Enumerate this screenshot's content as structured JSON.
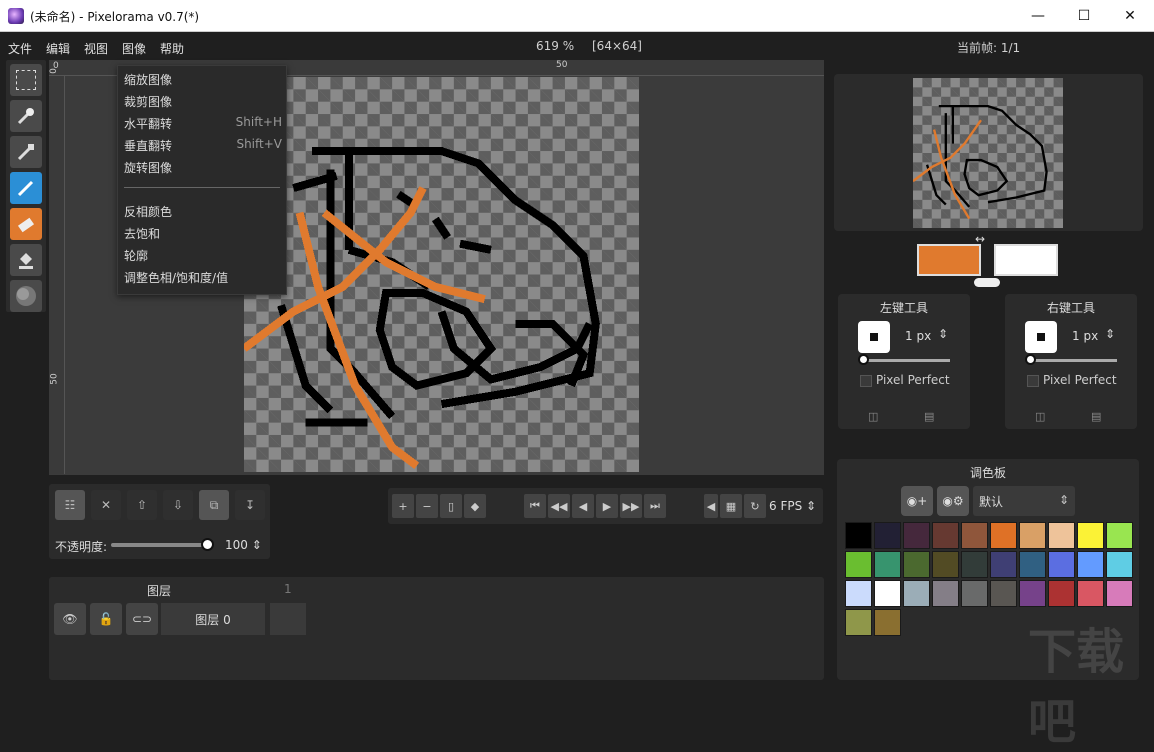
{
  "window": {
    "title": "(未命名) - Pixelorama v0.7(*)",
    "controls": [
      "minimize-icon",
      "maximize-icon",
      "close-icon"
    ]
  },
  "menubar": {
    "items": [
      "文件",
      "编辑",
      "视图",
      "图像",
      "帮助"
    ],
    "zoom": "619 %",
    "canvas_size": "[64×64]",
    "current_frame": "当前帧: 1/1"
  },
  "ruler": {
    "top_marks": [
      "0",
      "50"
    ],
    "left_marks": [
      "0",
      "50"
    ]
  },
  "image_menu": {
    "items": [
      {
        "label": "缩放图像",
        "shortcut": ""
      },
      {
        "label": "裁剪图像",
        "shortcut": ""
      },
      {
        "label": "水平翻转",
        "shortcut": "Shift+H"
      },
      {
        "label": "垂直翻转",
        "shortcut": "Shift+V"
      },
      {
        "label": "旋转图像",
        "shortcut": ""
      },
      {
        "label": "反相颜色",
        "shortcut": ""
      },
      {
        "label": "去饱和",
        "shortcut": ""
      },
      {
        "label": "轮廓",
        "shortcut": ""
      },
      {
        "label": "调整色相/饱和度/值",
        "shortcut": ""
      }
    ]
  },
  "tools": [
    "rect-select-icon",
    "magic-wand-icon",
    "color-picker-icon",
    "pencil-icon",
    "eraser-icon",
    "bucket-icon",
    "lighten-darken-icon"
  ],
  "layer_panel": {
    "opacity_label": "不透明度:",
    "opacity_value": "100",
    "title": "图层",
    "frame_column": "1",
    "layer_name": "图层 0"
  },
  "animation": {
    "fps": "6 FPS"
  },
  "tool_options": {
    "left": {
      "title": "左键工具",
      "size": "1 px",
      "pixel_perfect": "Pixel Perfect"
    },
    "right": {
      "title": "右键工具",
      "size": "1 px",
      "pixel_perfect": "Pixel Perfect"
    }
  },
  "colors": {
    "left": "#e07a2e",
    "right": "#ffffff",
    "accent": "#2b8fd6"
  },
  "palette": {
    "title": "调色板",
    "selected": "默认",
    "swatches": [
      "#000000",
      "#222034",
      "#45283c",
      "#663931",
      "#8f563b",
      "#df7126",
      "#d9a066",
      "#eec39a",
      "#fbf236",
      "#99e550",
      "#6abe30",
      "#37946e",
      "#4b692f",
      "#524b24",
      "#323c39",
      "#3f3f74",
      "#306082",
      "#5b6ee1",
      "#639bff",
      "#5fcde4",
      "#cbdbfc",
      "#ffffff",
      "#9badb7",
      "#847e87",
      "#696a6a",
      "#595652",
      "#76428a",
      "#ac3232",
      "#d95763",
      "#d77bba",
      "#8f974a",
      "#8a6f30"
    ]
  },
  "watermark": "下载吧"
}
